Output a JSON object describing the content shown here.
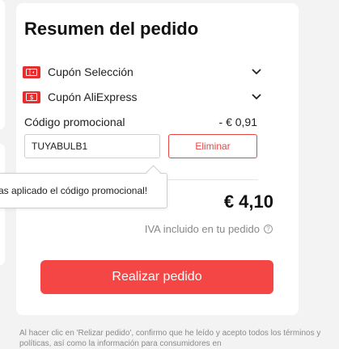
{
  "summary": {
    "title": "Resumen del pedido",
    "coupons": [
      {
        "label": "Cupón Selección",
        "icon": "coupon-ticket-icon"
      },
      {
        "label": "Cupón AliExpress",
        "icon": "coupon-dollar-icon"
      }
    ],
    "promo": {
      "label": "Código promocional",
      "value": "- € 0,91",
      "input_value": "TUYABULB1",
      "remove_label": "Eliminar"
    },
    "tooltip": "as aplicado el código promocional!",
    "total": "€ 4,10",
    "tax_note": "IVA incluido en tu pedido",
    "order_button": "Realizar pedido"
  },
  "disclaimer": "Al hacer clic en 'Relizar pedido', confirmo que he leído y acepto todos los términos y políticas, así como la información para consumidores en",
  "colors": {
    "accent": "#f54646",
    "coupon_icon": "#e62e2e",
    "remove_border": "#e64545"
  }
}
